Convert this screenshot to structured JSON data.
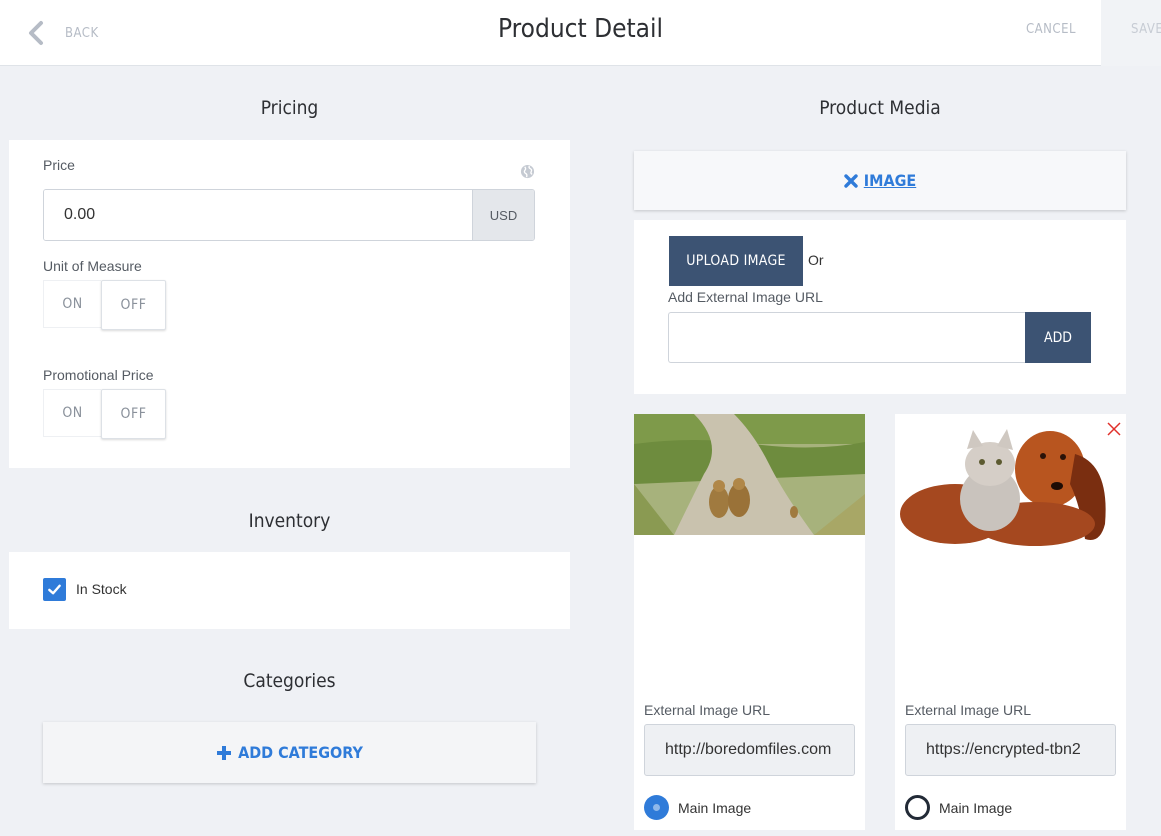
{
  "header": {
    "back_label": "BACK",
    "title": "Product Detail",
    "cancel_label": "CANCEL",
    "save_label": "SAVE"
  },
  "pricing": {
    "title": "Pricing",
    "price_label": "Price",
    "price_value": "0.00",
    "currency": "USD",
    "uom_label": "Unit of Measure",
    "uom_on": "ON",
    "uom_off": "OFF",
    "uom_selected": "OFF",
    "promo_label": "Promotional Price",
    "promo_on": "ON",
    "promo_off": "OFF",
    "promo_selected": "OFF",
    "globe_icon": "globe-icon"
  },
  "inventory": {
    "title": "Inventory",
    "in_stock_label": "In Stock",
    "in_stock_checked": true
  },
  "categories": {
    "title": "Categories",
    "add_label": "ADD CATEGORY"
  },
  "media": {
    "title": "Product Media",
    "image_toggle_label": "IMAGE",
    "upload_label": "UPLOAD IMAGE",
    "or_label": "Or",
    "external_url_label": "Add External Image URL",
    "external_url_value": "",
    "add_label": "ADD",
    "images": [
      {
        "url_label": "External Image URL",
        "url_value": "http://boredomfiles.com",
        "main_label": "Main Image",
        "is_main": true,
        "image_icon": "lions-on-road-image"
      },
      {
        "url_label": "External Image URL",
        "url_value": "https://encrypted-tbn2",
        "main_label": "Main Image",
        "is_main": false,
        "image_icon": "kitten-and-dachshund-image"
      }
    ]
  },
  "colors": {
    "accent": "#2f7bd9",
    "button_dark": "#3c5373",
    "background": "#eff1f5",
    "remove": "#e0302a"
  }
}
